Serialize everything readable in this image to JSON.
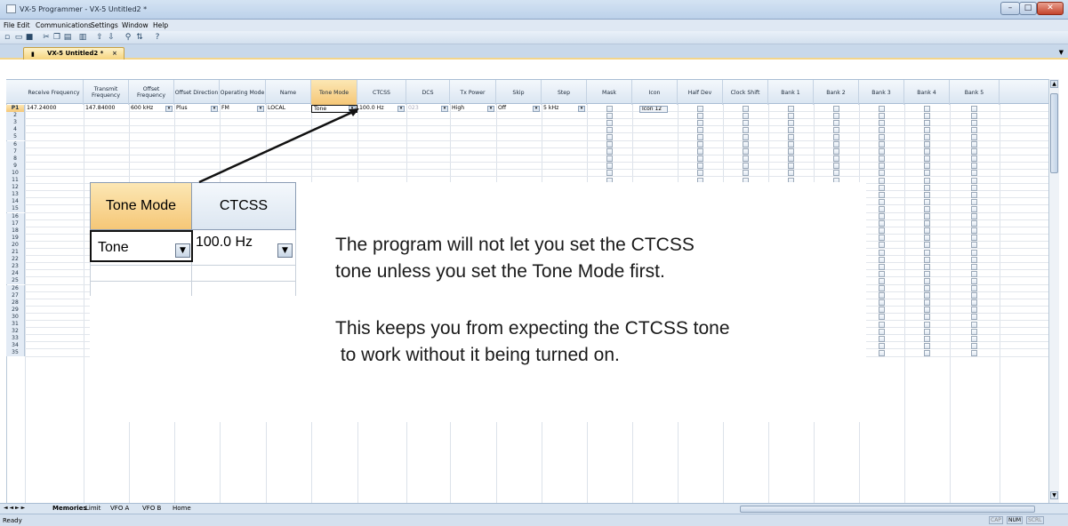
{
  "window": {
    "title": "VX-5 Programmer - VX-5 Untitled2 *",
    "minimize_glyph": "–",
    "maximize_glyph": "□",
    "close_glyph": "✕"
  },
  "menu": [
    "File",
    "Edit",
    "Communications",
    "Settings",
    "Window",
    "Help"
  ],
  "toolbar_icons": [
    "new-icon",
    "open-icon",
    "save-icon",
    "cut-icon",
    "copy-icon",
    "paste-icon",
    "print-icon",
    "upload-icon",
    "download-icon",
    "find-icon",
    "sort-icon",
    "help-icon"
  ],
  "document_tab": {
    "label": "VX-5 Untitled2 *",
    "close": "×"
  },
  "grid": {
    "columns": [
      "Receive Frequency",
      "Transmit Frequency",
      "Offset Frequency",
      "Offset Direction",
      "Operating Mode",
      "Name",
      "Tone Mode",
      "CTCSS",
      "DCS",
      "Tx Power",
      "Skip",
      "Step",
      "Mask",
      "Icon",
      "Half Dev",
      "Clock Shift",
      "Bank 1",
      "Bank 2",
      "Bank 3",
      "Bank 4",
      "Bank 5"
    ],
    "selected_column": "Tone Mode",
    "row_labels": [
      "P1",
      "2",
      "3",
      "4",
      "5",
      "6",
      "7",
      "8",
      "9",
      "10",
      "11",
      "12",
      "13",
      "14",
      "15",
      "16",
      "17",
      "18",
      "19",
      "20",
      "21",
      "22",
      "23",
      "24",
      "25",
      "26",
      "27",
      "28",
      "29",
      "30",
      "31",
      "32",
      "33",
      "34",
      "35"
    ],
    "first_row": {
      "receive_frequency": "147.24000",
      "transmit_frequency": "147.84000",
      "offset_frequency": "600 kHz",
      "offset_direction": "Plus",
      "operating_mode": "FM",
      "name": "LOCAL",
      "tone_mode": "Tone",
      "ctcss": "100.0 Hz",
      "dcs": "023",
      "tx_power": "High",
      "skip": "Off",
      "step": "5 kHz",
      "icon": "Icon 12"
    }
  },
  "sheet_tabs": [
    "Memories",
    "Limit",
    "VFO A",
    "VFO B",
    "Home"
  ],
  "status": {
    "text": "Ready",
    "indicators": [
      "CAP",
      "NUM",
      "SCRL"
    ],
    "active_indicator": "NUM"
  },
  "callout": {
    "zoom_headers": [
      "Tone Mode",
      "CTCSS"
    ],
    "zoom_values": [
      "Tone",
      "100.0 Hz"
    ],
    "message1": "The program will not let you set the CTCSS\ntone unless you set the Tone Mode first.",
    "message2": "This keeps you from expecting the CTCSS tone\n to work without it being turned on."
  }
}
